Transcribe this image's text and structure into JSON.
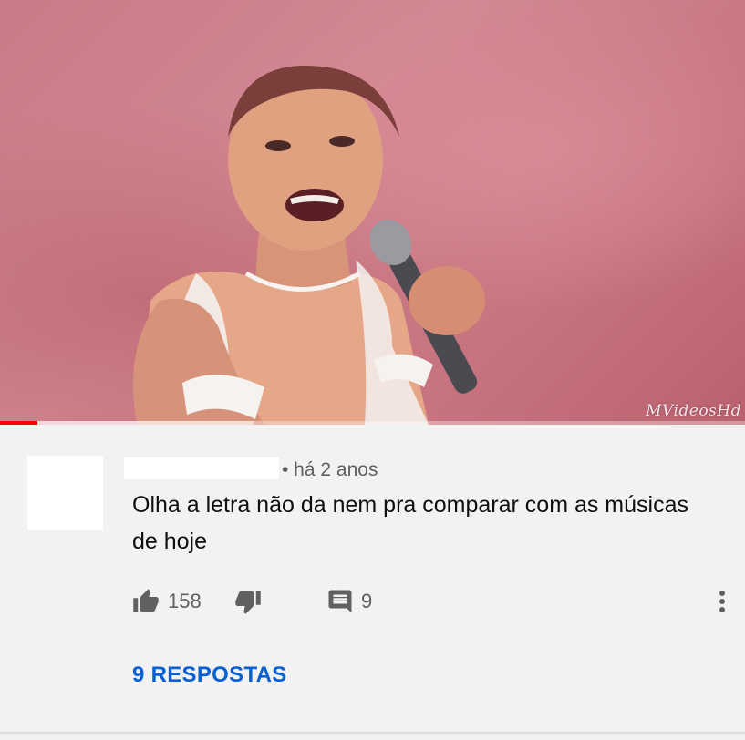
{
  "video": {
    "watermark": "MVideosHd",
    "progress_played_fraction": 0.05,
    "progress_buffered_fraction": 0.34
  },
  "comment": {
    "meta": "• há 2 anos",
    "text": "Olha a letra não da nem pra comparar com as músicas de hoje",
    "likes": "158",
    "reply_count": "9",
    "replies_link": "9 RESPOSTAS"
  },
  "icons": {
    "like": "thumbs-up-icon",
    "dislike": "thumbs-down-icon",
    "reply": "comment-icon",
    "more": "vertical-dots-icon"
  },
  "colors": {
    "accent_link": "#065fd4",
    "progress_red": "#ff0000"
  }
}
